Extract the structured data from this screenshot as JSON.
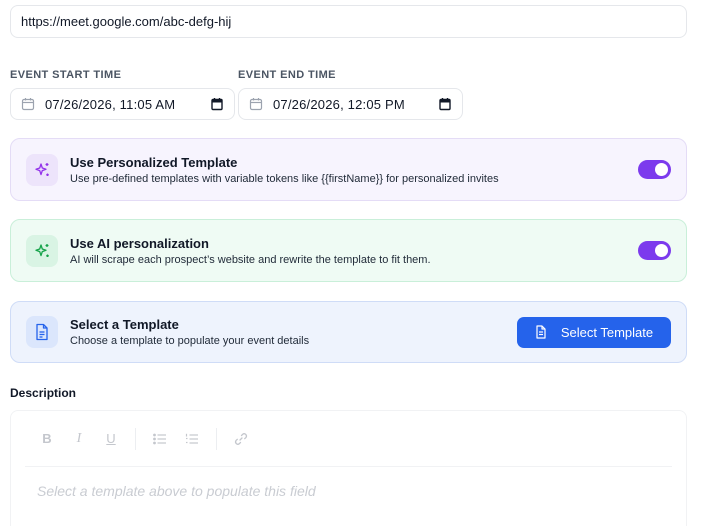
{
  "meeting_link": {
    "value": "https://meet.google.com/abc-defg-hij"
  },
  "event_start": {
    "label": "EVENT START TIME",
    "value": "07/26/2026, 11:05 AM"
  },
  "event_end": {
    "label": "EVENT END TIME",
    "value": "07/26/2026, 12:05 PM"
  },
  "personalized_template": {
    "title": "Use Personalized Template",
    "description": "Use pre-defined templates with variable tokens like {{firstName}} for personalized invites",
    "enabled": true,
    "icon": "sparkles-icon",
    "accent": "#9333ea"
  },
  "ai_personalization": {
    "title": "Use AI personalization",
    "description": "AI will scrape each prospect’s website and rewrite the template to fit them.",
    "enabled": true,
    "icon": "sparkles-icon",
    "accent": "#16a34a"
  },
  "select_template": {
    "title": "Select a Template",
    "description": "Choose a template to populate your event details",
    "button_label": "Select Template",
    "icon": "document-icon",
    "accent": "#2563eb"
  },
  "description": {
    "label": "Description",
    "placeholder": "Select a template above to populate this field",
    "toolbar": {
      "bold": "B",
      "italic": "I",
      "underline": "U"
    }
  },
  "colors": {
    "toggle_on": "#7c3aed",
    "primary_button": "#2563eb"
  }
}
